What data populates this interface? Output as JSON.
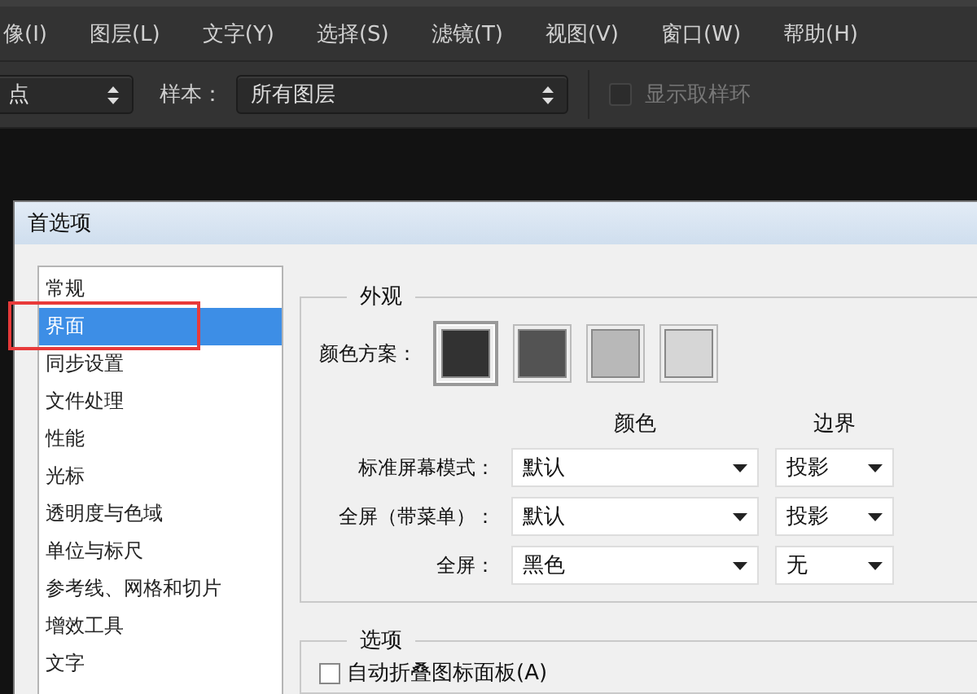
{
  "menu": [
    {
      "label": "像(I)"
    },
    {
      "label": "图层(L)"
    },
    {
      "label": "文字(Y)"
    },
    {
      "label": "选择(S)"
    },
    {
      "label": "滤镜(T)"
    },
    {
      "label": "视图(V)"
    },
    {
      "label": "窗口(W)"
    },
    {
      "label": "帮助(H)"
    }
  ],
  "options_bar": {
    "mode_dropdown": {
      "value": "点"
    },
    "sample_label": "样本：",
    "sample_dropdown": {
      "value": "所有图层"
    },
    "show_ring": {
      "label": "显示取样环",
      "checked": false,
      "disabled": true
    }
  },
  "dialog": {
    "title": "首选项",
    "categories": [
      {
        "label": "常规",
        "selected": false,
        "annotated": false
      },
      {
        "label": "界面",
        "selected": true,
        "annotated": true
      },
      {
        "label": "同步设置",
        "selected": false,
        "annotated": false
      },
      {
        "label": "文件处理",
        "selected": false,
        "annotated": false
      },
      {
        "label": "性能",
        "selected": false,
        "annotated": false
      },
      {
        "label": "光标",
        "selected": false,
        "annotated": false
      },
      {
        "label": "透明度与色域",
        "selected": false,
        "annotated": false
      },
      {
        "label": "单位与标尺",
        "selected": false,
        "annotated": false
      },
      {
        "label": "参考线、网格和切片",
        "selected": false,
        "annotated": false
      },
      {
        "label": "增效工具",
        "selected": false,
        "annotated": false
      },
      {
        "label": "文字",
        "selected": false,
        "annotated": false
      }
    ],
    "appearance": {
      "title": "外观",
      "color_scheme_label": "颜色方案：",
      "swatches": [
        {
          "color": "#323232",
          "selected": true
        },
        {
          "color": "#535353",
          "selected": false
        },
        {
          "color": "#b8b8b8",
          "selected": false
        },
        {
          "color": "#d6d6d6",
          "selected": false
        }
      ],
      "color_header": "颜色",
      "border_header": "边界",
      "rows": [
        {
          "label": "标准屏幕模式：",
          "color_mode": "默认",
          "border_mode": "投影"
        },
        {
          "label": "全屏（带菜单）：",
          "color_mode": "默认",
          "border_mode": "投影"
        },
        {
          "label": "全屏：",
          "color_mode": "黑色",
          "border_mode": "无"
        }
      ]
    },
    "options": {
      "title": "选项",
      "checkboxes": [
        {
          "label": "自动折叠图标面板(A)",
          "checked": false
        }
      ]
    }
  }
}
